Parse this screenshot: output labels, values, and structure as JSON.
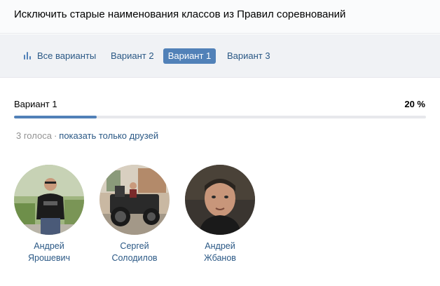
{
  "poll": {
    "title": "Исключить старые наименования классов из Правил соревнований"
  },
  "tabs": [
    {
      "label": "Все варианты",
      "active": false,
      "icon": "bar-chart-icon"
    },
    {
      "label": "Вариант 2",
      "active": false
    },
    {
      "label": "Вариант 1",
      "active": true
    },
    {
      "label": "Вариант 3",
      "active": false
    }
  ],
  "result": {
    "label": "Вариант 1",
    "percent_text": "20 %",
    "percent": 20,
    "vote_count_text": "3 голоса",
    "separator": "·",
    "friends_link": "показать только друзей"
  },
  "voters": [
    {
      "first": "Андрей",
      "last": "Ярошевич"
    },
    {
      "first": "Сергей",
      "last": "Солодилов"
    },
    {
      "first": "Андрей",
      "last": "Жбанов"
    }
  ],
  "colors": {
    "accent": "#5181b8",
    "link": "#2a5885",
    "muted": "#939393",
    "track": "#e7e8ec"
  }
}
